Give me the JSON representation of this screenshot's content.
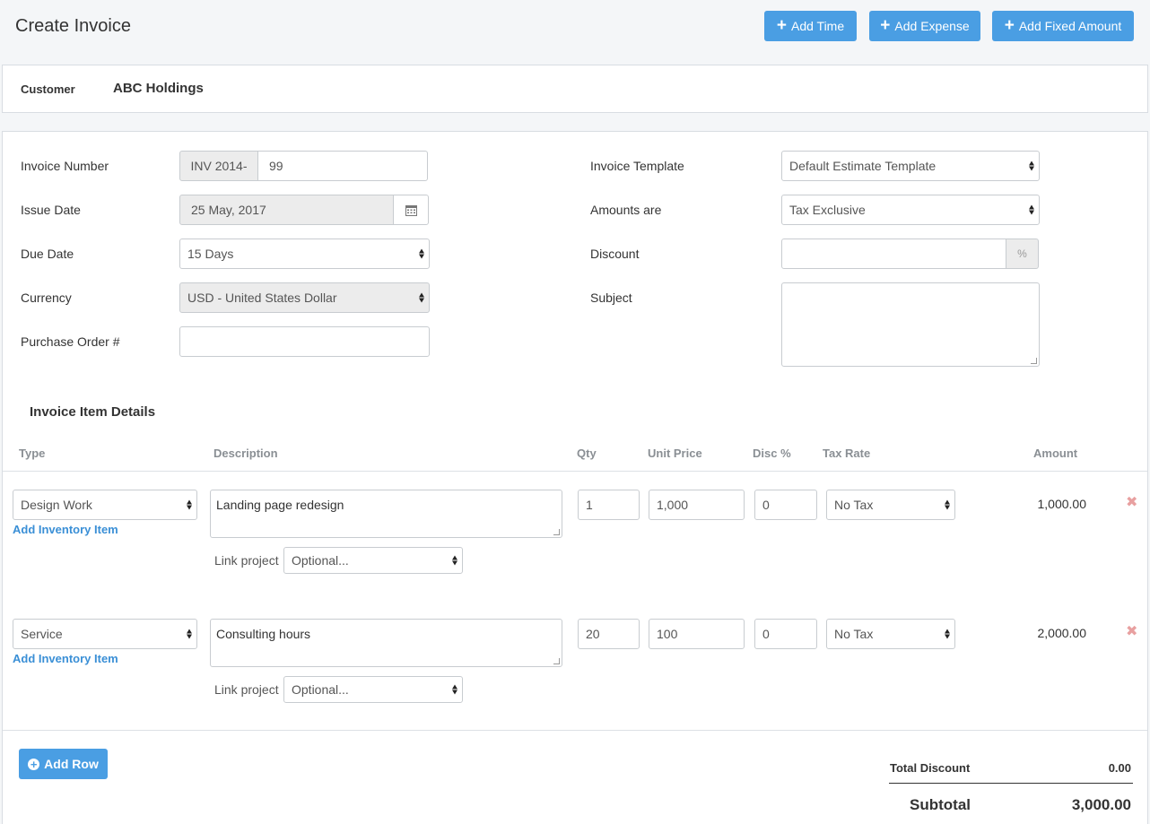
{
  "header": {
    "title": "Create Invoice",
    "buttons": {
      "add_time": "Add Time",
      "add_expense": "Add Expense",
      "add_fixed": "Add Fixed Amount"
    }
  },
  "customer": {
    "label": "Customer",
    "value": "ABC Holdings"
  },
  "form": {
    "invoice_number": {
      "label": "Invoice Number",
      "prefix": "INV 2014-",
      "value": "99"
    },
    "issue_date": {
      "label": "Issue Date",
      "value": "25 May, 2017"
    },
    "due_date": {
      "label": "Due Date",
      "value": "15 Days"
    },
    "currency": {
      "label": "Currency",
      "value": "USD - United States Dollar"
    },
    "purchase_order": {
      "label": "Purchase Order #",
      "value": ""
    },
    "invoice_template": {
      "label": "Invoice Template",
      "value": "Default Estimate Template"
    },
    "amounts_are": {
      "label": "Amounts are",
      "value": "Tax Exclusive"
    },
    "discount": {
      "label": "Discount",
      "value": "",
      "suffix": "%"
    },
    "subject": {
      "label": "Subject",
      "value": ""
    }
  },
  "items": {
    "title": "Invoice Item Details",
    "columns": {
      "type": "Type",
      "description": "Description",
      "qty": "Qty",
      "unit_price": "Unit Price",
      "disc": "Disc %",
      "tax_rate": "Tax Rate",
      "amount": "Amount"
    },
    "add_inventory": "Add Inventory Item",
    "link_project": "Link project",
    "rows": [
      {
        "type": "Design Work",
        "description": "Landing page redesign",
        "project": "Optional...",
        "qty": "1",
        "unit_price": "1,000",
        "disc": "0",
        "tax": "No Tax",
        "amount": "1,000.00"
      },
      {
        "type": "Service",
        "description": "Consulting hours",
        "project": "Optional...",
        "qty": "20",
        "unit_price": "100",
        "disc": "0",
        "tax": "No Tax",
        "amount": "2,000.00"
      }
    ]
  },
  "add_row": "Add Row",
  "totals": {
    "total_discount": {
      "label": "Total Discount",
      "value": "0.00"
    },
    "subtotal": {
      "label": "Subtotal",
      "value": "3,000.00"
    }
  },
  "colors": {
    "primary": "#4a9ee3",
    "link": "#3a8fd6",
    "remove": "#e8a0a0"
  }
}
